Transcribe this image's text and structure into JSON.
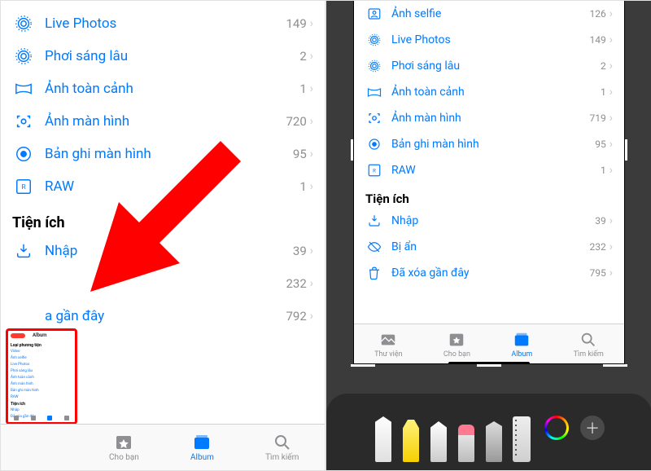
{
  "tabs": [
    "Thư viện",
    "Cho bạn",
    "Album",
    "Tìm kiếm"
  ],
  "left": {
    "rows": [
      {
        "label": "Live Photos",
        "count": "149"
      },
      {
        "label": "Phơi sáng lâu",
        "count": "2"
      },
      {
        "label": "Ảnh toàn cảnh",
        "count": "1"
      },
      {
        "label": "Ảnh màn hình",
        "count": "720"
      },
      {
        "label": "Bản ghi màn hình",
        "count": "95"
      },
      {
        "label": "RAW",
        "count": "1"
      }
    ],
    "utilities_header": "Tiện ích",
    "util": [
      {
        "label": "Nhập",
        "count": "39"
      },
      {
        "label": "",
        "count": "232"
      },
      {
        "label": "a gần đây",
        "count": "792"
      }
    ]
  },
  "right": {
    "rows": [
      {
        "label": "Ảnh selfie",
        "count": "126"
      },
      {
        "label": "Live Photos",
        "count": "149"
      },
      {
        "label": "Phơi sáng lâu",
        "count": "2"
      },
      {
        "label": "Ảnh toàn cảnh",
        "count": "1"
      },
      {
        "label": "Ảnh màn hình",
        "count": "719"
      },
      {
        "label": "Bản ghi màn hình",
        "count": "95"
      },
      {
        "label": "RAW",
        "count": "1"
      }
    ],
    "utilities_header": "Tiện ích",
    "util": [
      {
        "label": "Nhập",
        "count": "39"
      },
      {
        "label": "Bị ẩn",
        "count": "232"
      },
      {
        "label": "Đã xóa gần đây",
        "count": "795"
      }
    ]
  },
  "thumb": {
    "title": "Album",
    "sec1": "Loại phương tiện",
    "sec2": "Tiện ích",
    "r": [
      "Video",
      "Ảnh selfie",
      "Live Photos",
      "Phơi sáng lâu",
      "Ảnh toàn cảnh",
      "Ảnh màn hình",
      "Bản ghi màn hình",
      "RAW",
      "Nhập",
      "Đã xóa gần đây"
    ]
  }
}
